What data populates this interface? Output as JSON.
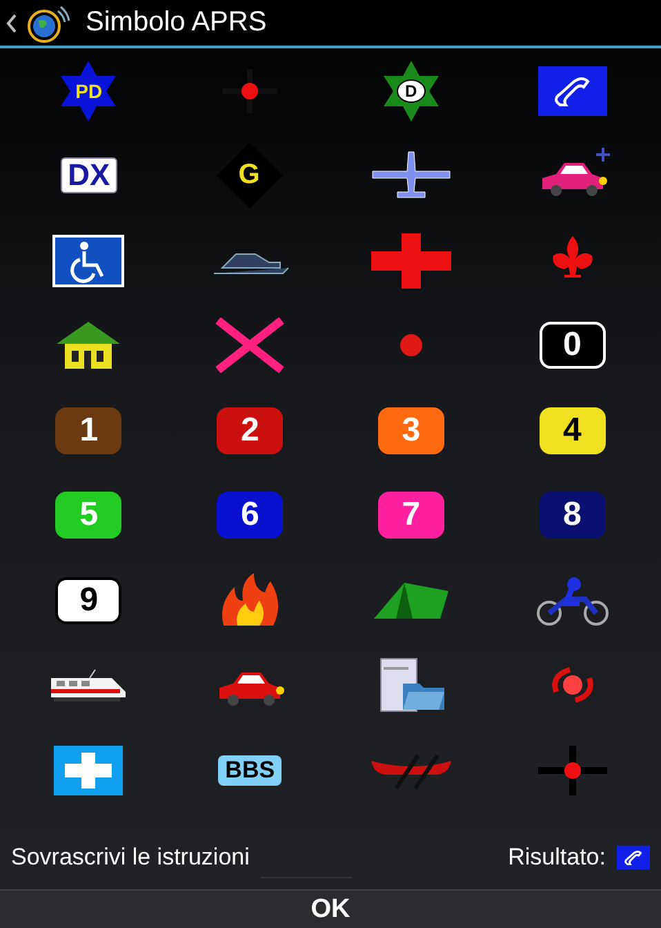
{
  "header": {
    "title": "Simbolo APRS"
  },
  "symbols": [
    {
      "kind": "star",
      "label": "PD",
      "color": "#0a14d8"
    },
    {
      "kind": "dot-cross"
    },
    {
      "kind": "star-circle",
      "label": "D",
      "color": "#1a8a1a"
    },
    {
      "kind": "phone"
    },
    {
      "kind": "dx",
      "label": "DX"
    },
    {
      "kind": "diamond",
      "label": "G"
    },
    {
      "kind": "plane"
    },
    {
      "kind": "car-antenna"
    },
    {
      "kind": "wheelchair"
    },
    {
      "kind": "snowmobile"
    },
    {
      "kind": "red-cross"
    },
    {
      "kind": "fleur"
    },
    {
      "kind": "house"
    },
    {
      "kind": "x-mark"
    },
    {
      "kind": "dot"
    },
    {
      "kind": "number",
      "label": "0",
      "color": "#000000"
    },
    {
      "kind": "number",
      "label": "1",
      "color": "#6b3a10"
    },
    {
      "kind": "number",
      "label": "2",
      "color": "#cc1010"
    },
    {
      "kind": "number",
      "label": "3",
      "color": "#ff6a10"
    },
    {
      "kind": "number",
      "label": "4",
      "color": "#f0e020"
    },
    {
      "kind": "number",
      "label": "5",
      "color": "#22cc22"
    },
    {
      "kind": "number",
      "label": "6",
      "color": "#0a10d0"
    },
    {
      "kind": "number",
      "label": "7",
      "color": "#ff20a0"
    },
    {
      "kind": "number",
      "label": "8",
      "color": "#0a1070"
    },
    {
      "kind": "number",
      "label": "9",
      "color": "#ffffff"
    },
    {
      "kind": "fire"
    },
    {
      "kind": "tent"
    },
    {
      "kind": "motorcycle"
    },
    {
      "kind": "train"
    },
    {
      "kind": "car"
    },
    {
      "kind": "server"
    },
    {
      "kind": "hurricane"
    },
    {
      "kind": "blue-cross"
    },
    {
      "kind": "bbs",
      "label": "BBS"
    },
    {
      "kind": "canoe"
    },
    {
      "kind": "crosshair"
    }
  ],
  "override": {
    "label": "Sovrascrivi le istruzioni"
  },
  "result": {
    "label": "Risultato:",
    "kind": "phone"
  },
  "ok_button": "OK"
}
